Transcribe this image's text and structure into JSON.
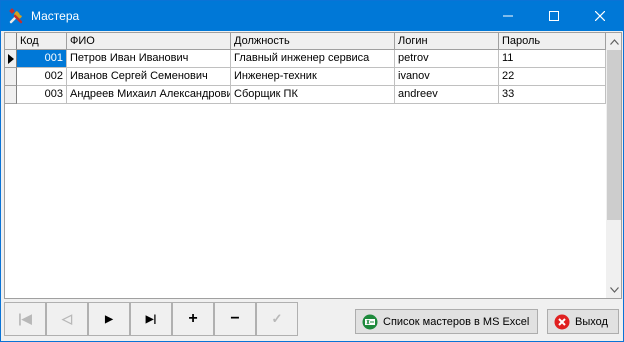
{
  "window": {
    "title": "Мастера",
    "icon": "tools-icon"
  },
  "titlebar_buttons": {
    "minimize": "minimize-icon",
    "maximize": "maximize-icon",
    "close": "close-icon"
  },
  "grid": {
    "columns": [
      "Код",
      "ФИО",
      "Должность",
      "Логин",
      "Пароль"
    ],
    "rows": [
      {
        "kod": "001",
        "fio": "Петров Иван Иванович",
        "dolzhnost": "Главный инженер сервиса",
        "login": "petrov",
        "parol": "11",
        "selected": true
      },
      {
        "kod": "002",
        "fio": "Иванов Сергей Семенович",
        "dolzhnost": "Инженер-техник",
        "login": "ivanov",
        "parol": "22",
        "selected": false
      },
      {
        "kod": "003",
        "fio": "Андреев Михаил Александрович",
        "dolzhnost": "Сборщик ПК",
        "login": "andreev",
        "parol": "33",
        "selected": false
      }
    ]
  },
  "navigator": {
    "first": "|◀",
    "prior": "◁",
    "next": "▶",
    "last": "▶|",
    "insert": "+",
    "delete": "−",
    "post": "✓"
  },
  "buttons": {
    "excel_label": "Список мастеров в MS Excel",
    "exit_label": "Выход"
  },
  "colors": {
    "titlebar": "#0078d7",
    "selection": "#0078d7",
    "excel_icon": "#1e8a3c",
    "exit_icon": "#e02020"
  }
}
